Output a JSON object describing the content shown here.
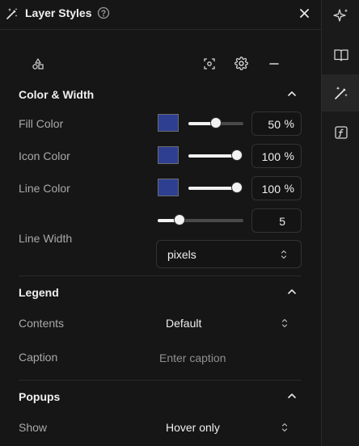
{
  "header": {
    "title": "Layer Styles",
    "help_icon": "help-circle-icon",
    "close_icon": "close-icon",
    "title_icon": "magic-wand-icon"
  },
  "toolbar": {
    "icons": [
      "shapes-icon",
      "focus-icon",
      "gear-icon",
      "minus-icon"
    ]
  },
  "color_width": {
    "title": "Color & Width",
    "fill_color": {
      "label": "Fill Color",
      "value": "50",
      "unit": "%",
      "color": "#2e3f92",
      "slider": 0.5
    },
    "icon_color": {
      "label": "Icon Color",
      "value": "100",
      "unit": "%",
      "color": "#2e3f92",
      "slider": 1.0
    },
    "line_color": {
      "label": "Line Color",
      "value": "100",
      "unit": "%",
      "color": "#2e3f92",
      "slider": 1.0
    },
    "line_width": {
      "label": "Line Width",
      "value": "5",
      "units": "pixels",
      "slider": 0.25
    }
  },
  "legend": {
    "title": "Legend",
    "contents_label": "Contents",
    "contents_value": "Default",
    "caption_label": "Caption",
    "caption_placeholder": "Enter caption"
  },
  "popups": {
    "title": "Popups",
    "show_label": "Show",
    "show_value": "Hover only"
  },
  "side_rail": {
    "icons": [
      "sparkles-icon",
      "book-icon",
      "magic-wand-icon",
      "function-icon"
    ],
    "active_index": 2
  }
}
